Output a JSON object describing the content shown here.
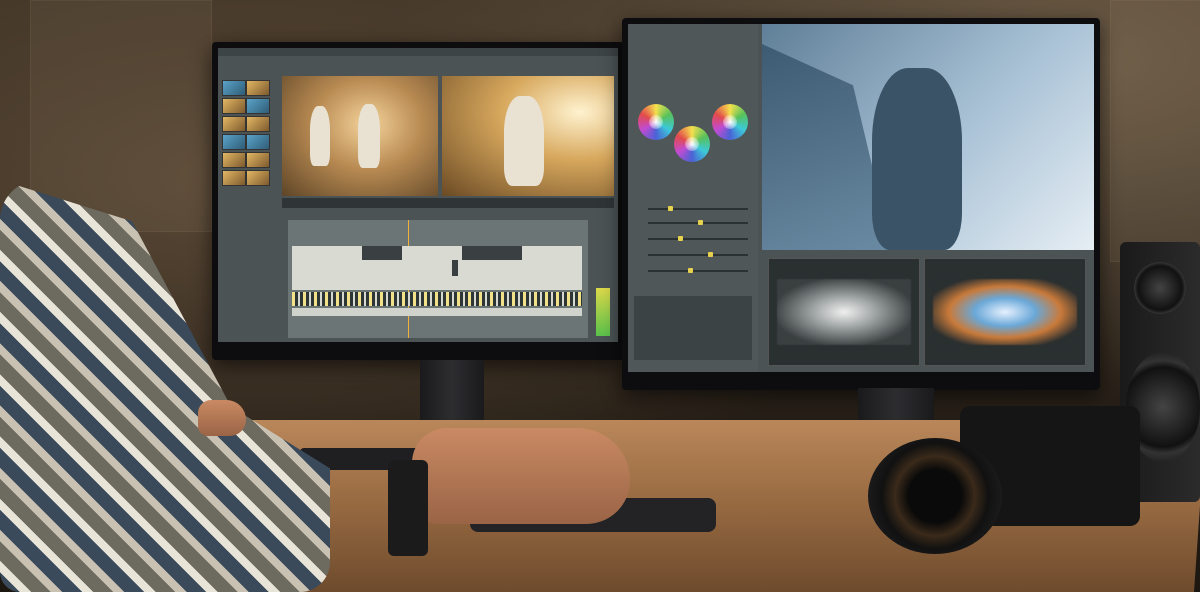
{
  "scene": {
    "description_tags": [
      "video-editing-setup",
      "dual-monitor"
    ],
    "colors": {
      "desk": "#b9875a",
      "screen_ui": "#4b5355",
      "accent_yellow": "#e8d14f"
    }
  },
  "icons": {
    "color_wheel": "color-wheel-icon",
    "speaker": "speaker-icon",
    "camera": "camera-icon"
  }
}
